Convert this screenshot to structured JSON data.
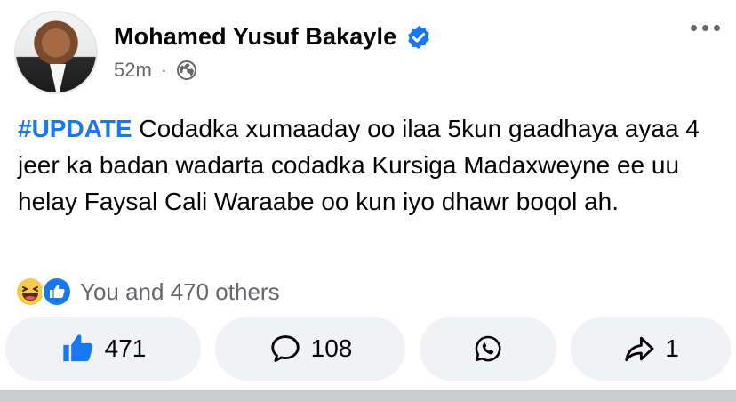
{
  "author": {
    "name": "Mohamed Yusuf Bakayle",
    "verified": true,
    "time": "52m",
    "separator": "·",
    "audience_icon": "globe-icon"
  },
  "post": {
    "hashtag": "#UPDATE",
    "text": " Codadka xumaaday oo ilaa 5kun gaadhaya ayaa 4 jeer ka badan wadarta codadka Kursiga Madaxweyne ee uu helay Faysal Cali Waraabe oo kun iyo dhawr boqol ah."
  },
  "reactions": {
    "icons": [
      "haha-icon",
      "like-icon"
    ],
    "summary": "You and 470 others"
  },
  "actions": {
    "like_count": "471",
    "comment_count": "108",
    "share_count": "1",
    "whatsapp_icon": "whatsapp-icon"
  },
  "colors": {
    "accent": "#1877f2",
    "secondary_text": "#65676b",
    "button_bg": "#f0f2f5"
  }
}
